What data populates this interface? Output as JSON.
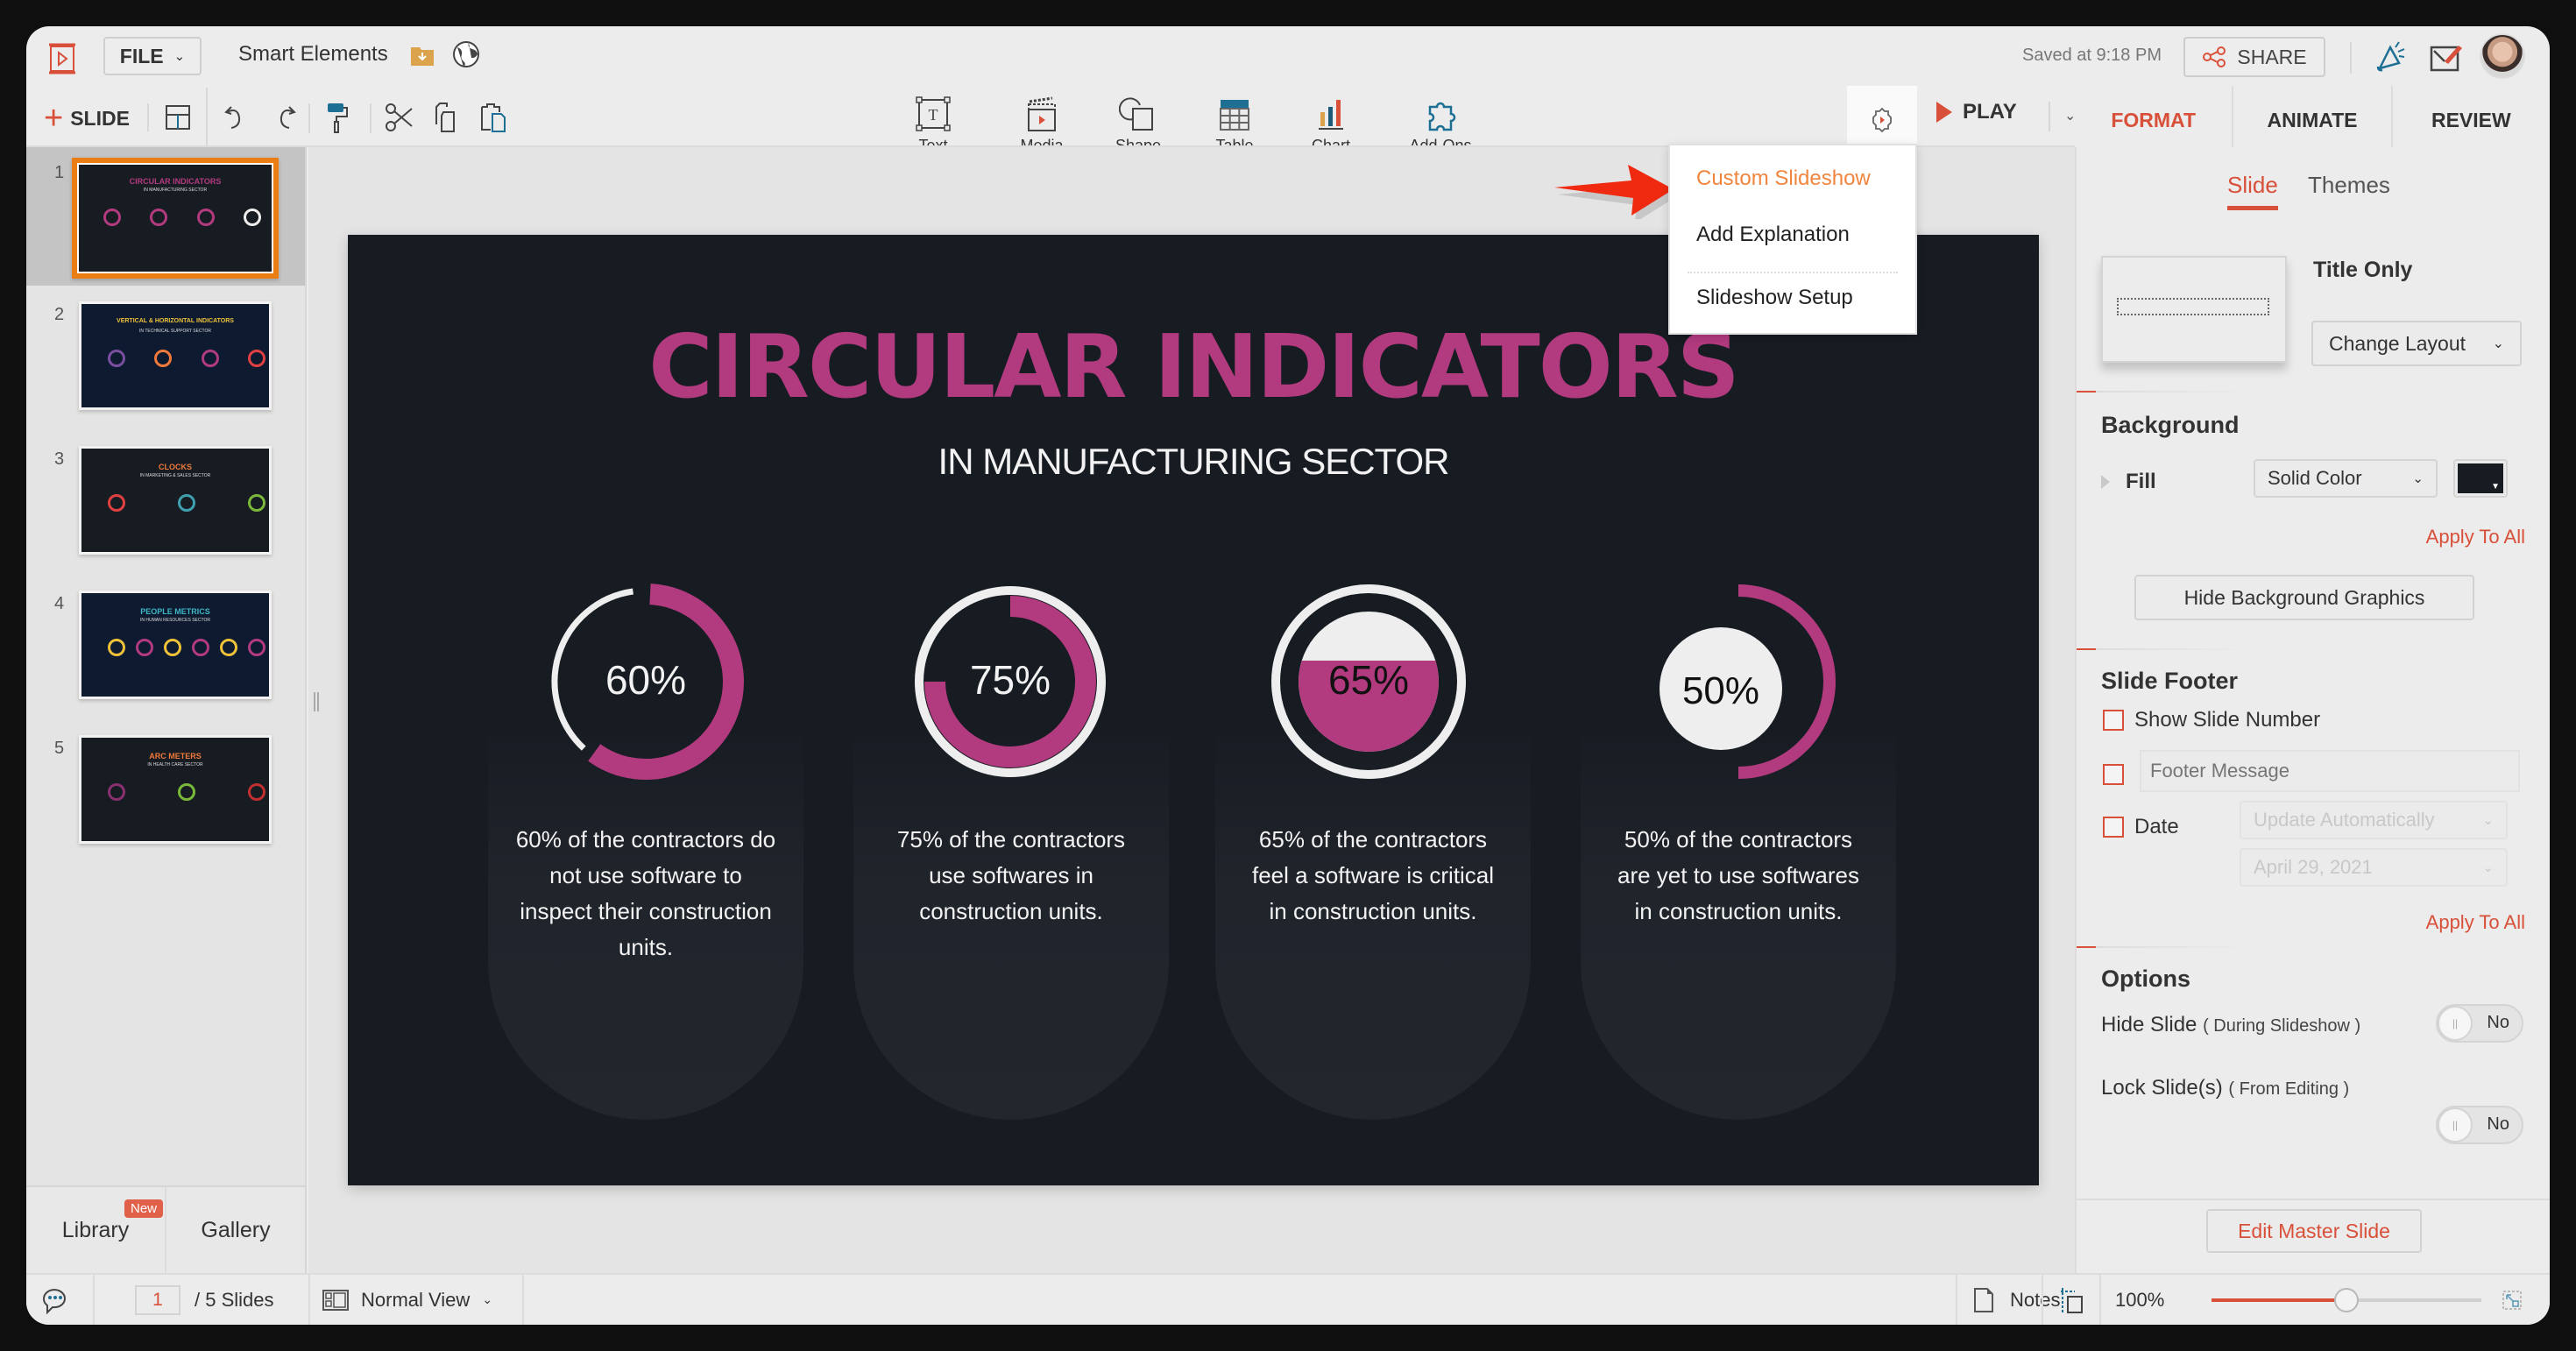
{
  "header": {
    "file_label": "FILE",
    "doc_title": "Smart Elements",
    "saved_status": "Saved at 9:18 PM",
    "share_label": "SHARE"
  },
  "toolbar": {
    "add_slide_label": "SLIDE",
    "insert_items": [
      {
        "label": "Text",
        "icon": "text-box-icon"
      },
      {
        "label": "Media",
        "icon": "clapperboard-icon"
      },
      {
        "label": "Shape",
        "icon": "shape-icon"
      },
      {
        "label": "Table",
        "icon": "table-icon"
      },
      {
        "label": "Chart",
        "icon": "bar-chart-icon"
      },
      {
        "label": "Add-Ons",
        "icon": "puzzle-icon"
      }
    ],
    "play_label": "PLAY"
  },
  "panel_tabs": [
    {
      "label": "FORMAT",
      "active": true
    },
    {
      "label": "ANIMATE",
      "active": false
    },
    {
      "label": "REVIEW",
      "active": false
    }
  ],
  "play_menu": {
    "items": [
      "Custom Slideshow",
      "Add Explanation",
      "Slideshow Setup"
    ],
    "highlighted": "Custom Slideshow"
  },
  "slides_panel": {
    "thumbnails": [
      {
        "number": "1",
        "title": "CIRCULAR INDICATORS",
        "subtitle": "IN MANUFACTURING SECTOR",
        "title_color": "#b23a7f",
        "bg": "#171b22",
        "selected": true
      },
      {
        "number": "2",
        "title": "VERTICAL & HORIZONTAL INDICATORS",
        "subtitle": "IN TECHNICAL SUPPORT SECTOR",
        "title_color": "#f0c23a",
        "bg": "#0d1a30",
        "selected": false
      },
      {
        "number": "3",
        "title": "CLOCKS",
        "subtitle": "IN MARKETING & SALES SECTOR",
        "title_color": "#f07a3a",
        "bg": "#171b22",
        "selected": false
      },
      {
        "number": "4",
        "title": "PEOPLE METRICS",
        "subtitle": "IN HUMAN RESOURCES SECTOR",
        "title_color": "#3fb6c4",
        "bg": "#0d1a30",
        "selected": false
      },
      {
        "number": "5",
        "title": "ARC METERS",
        "subtitle": "IN HEALTH CARE SECTOR",
        "title_color": "#f07a3a",
        "bg": "#171b22",
        "selected": false
      }
    ],
    "library_label": "Library",
    "library_badge": "New",
    "gallery_label": "Gallery"
  },
  "slide": {
    "title": "CIRCULAR INDICATORS",
    "subtitle": "IN MANUFACTURING SECTOR",
    "accent": "#b23a7f",
    "indicators": [
      {
        "value": 60,
        "label": "60%",
        "style": "open-ring",
        "text": "60% of the contractors do not use software to inspect their construction units."
      },
      {
        "value": 75,
        "label": "75%",
        "style": "ring-in-circle",
        "text": "75% of the contractors use softwares in construction units."
      },
      {
        "value": 65,
        "label": "65%",
        "style": "fill-level",
        "text": "65% of the contractors feel a software is critical in construction units."
      },
      {
        "value": 50,
        "label": "50%",
        "style": "side-arc",
        "text": "50% of the contractors are yet to use softwares in construction units."
      }
    ]
  },
  "format_panel": {
    "subtabs": [
      {
        "label": "Slide",
        "active": true
      },
      {
        "label": "Themes",
        "active": false
      }
    ],
    "layout_name": "Title Only",
    "change_layout_label": "Change Layout",
    "background_heading": "Background",
    "fill_label": "Fill",
    "fill_type": "Solid Color",
    "fill_color": "#171b22",
    "apply_to_all": "Apply To All",
    "hide_bg_graphics": "Hide Background Graphics",
    "footer_heading": "Slide Footer",
    "show_slide_number": "Show Slide Number",
    "footer_message_placeholder": "Footer Message",
    "date_label": "Date",
    "date_mode": "Update Automatically",
    "date_value": "April 29, 2021",
    "options_heading": "Options",
    "hide_slide_label": "Hide Slide",
    "hide_slide_note": "( During Slideshow )",
    "hide_slide_value": "No",
    "lock_slide_label": "Lock Slide(s)",
    "lock_slide_note": "( From Editing )",
    "lock_slide_value": "No",
    "edit_master_label": "Edit Master Slide"
  },
  "status_bar": {
    "current_page": "1",
    "total_label": "/ 5 Slides",
    "view_label": "Normal View",
    "notes_label": "Notes",
    "zoom_label": "100%",
    "zoom_fraction": 0.5
  }
}
